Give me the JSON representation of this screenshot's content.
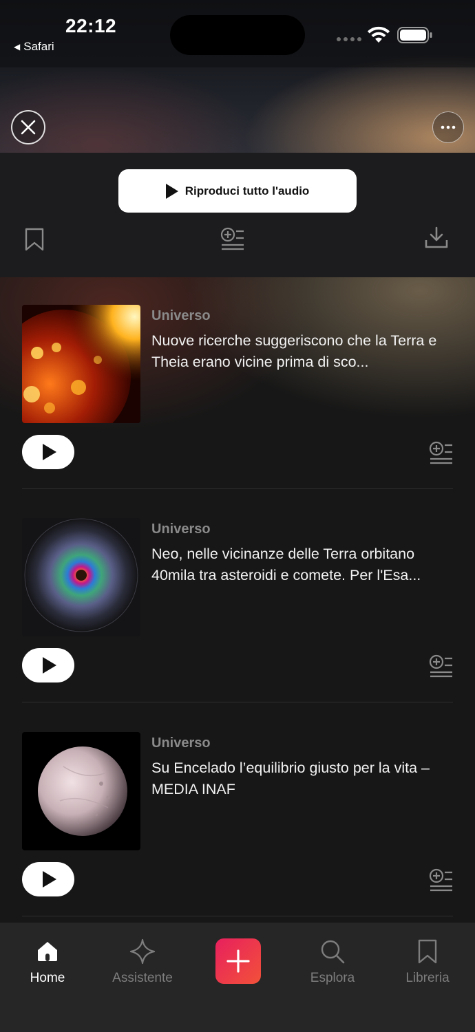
{
  "status_bar": {
    "time": "22:12",
    "back_label": "Safari"
  },
  "header": {
    "close_icon": "close-icon",
    "more_icon": "more-icon"
  },
  "actions": {
    "play_all_label": "Riproduci tutto l'audio",
    "bookmark_icon": "bookmark-icon",
    "queue_icon": "add-to-queue-icon",
    "download_icon": "download-icon"
  },
  "articles": [
    {
      "category": "Universo",
      "title": "Nuove ricerche suggeriscono che la Terra e Theia erano vicine prima di sco...",
      "thumbnail": "molten-planet"
    },
    {
      "category": "Universo",
      "title": "Neo, nelle vicinanze delle Terra orbitano 40mila tra asteroidi e comete. Per l'Esa...",
      "thumbnail": "asteroid-map"
    },
    {
      "category": "Universo",
      "title": "Su Encelado l’equilibrio giusto per la vita – MEDIA INAF",
      "thumbnail": "enceladus-moon"
    }
  ],
  "tabbar": {
    "home": "Home",
    "assistant": "Assistente",
    "explore": "Esplora",
    "library": "Libreria",
    "active_tab": "home"
  },
  "colors": {
    "background": "#151515",
    "tabbar": "#262626",
    "fab_start": "#e8205e",
    "fab_end": "#f2513a",
    "muted_text": "#8a8a8a"
  }
}
